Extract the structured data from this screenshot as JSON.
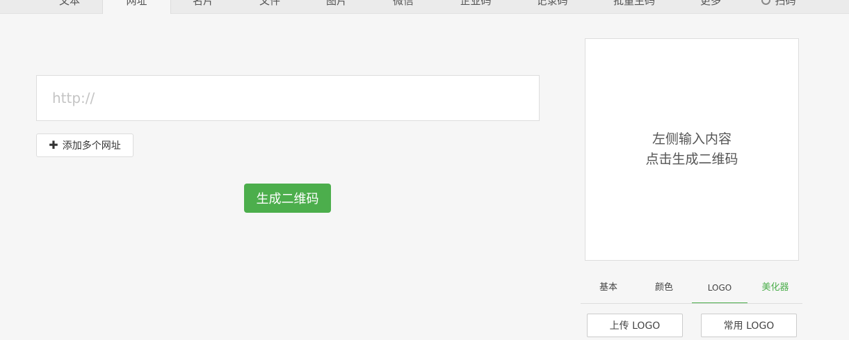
{
  "tabs": [
    {
      "label": "文本"
    },
    {
      "label": "网址"
    },
    {
      "label": "名片"
    },
    {
      "label": "文件"
    },
    {
      "label": "图片"
    },
    {
      "label": "微信"
    },
    {
      "label": "企业码"
    },
    {
      "label": "记录码"
    },
    {
      "label": "批量生码"
    },
    {
      "label": "更多"
    },
    {
      "label": "扫码",
      "icon": "scan-icon"
    }
  ],
  "active_tab": "网址",
  "main": {
    "url_placeholder": "http://",
    "url_value": "",
    "add_label": "添加多个网址",
    "add_icon": "plus-icon",
    "generate_label": "生成二维码"
  },
  "preview": {
    "line1": "左侧输入内容",
    "line2": "点击生成二维码"
  },
  "style_tabs": [
    {
      "label": "基本"
    },
    {
      "label": "颜色"
    },
    {
      "label": "LOGO"
    },
    {
      "label": "美化器"
    }
  ],
  "active_style_tab": "LOGO",
  "logo": {
    "upload_label": "上传 LOGO",
    "common_label": "常用 LOGO"
  },
  "colors": {
    "accent": "#4cae4c",
    "background": "#f6f6f6"
  }
}
